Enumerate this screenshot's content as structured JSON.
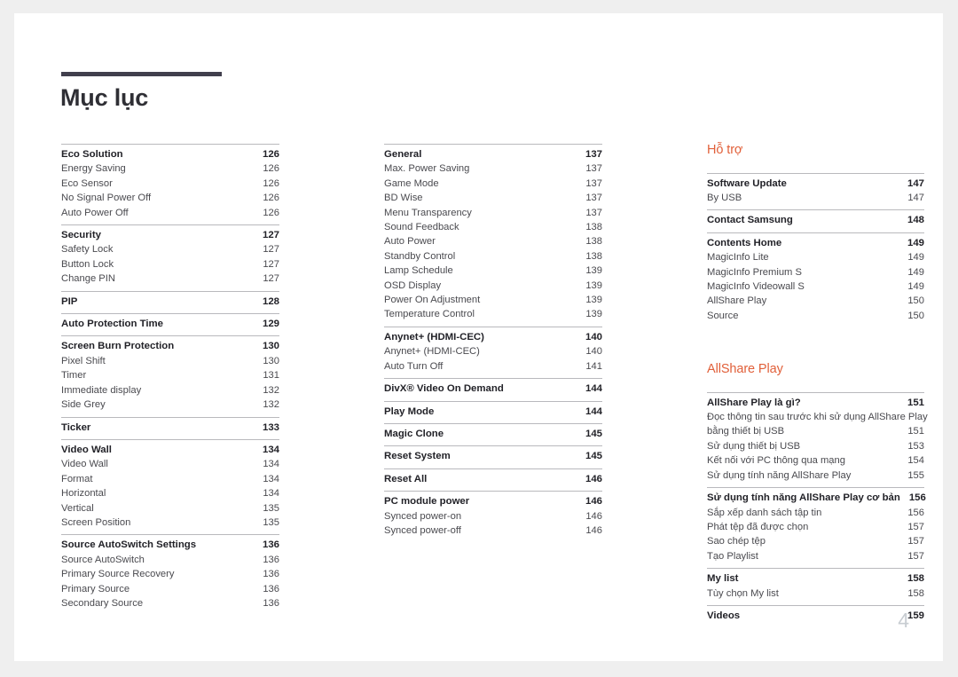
{
  "document": {
    "title": "Mục lục",
    "folio": "4",
    "accent_color": "#e1603a",
    "rule_color": "#413f4d"
  },
  "columns": [
    {
      "name": "column-one",
      "heading": null,
      "groups": [
        {
          "rows": [
            {
              "label": "Eco Solution",
              "page": "126",
              "type": "head"
            },
            {
              "label": "Energy Saving",
              "page": "126",
              "type": "sub"
            },
            {
              "label": "Eco Sensor",
              "page": "126",
              "type": "sub"
            },
            {
              "label": "No Signal Power Off",
              "page": "126",
              "type": "sub"
            },
            {
              "label": "Auto Power Off",
              "page": "126",
              "type": "sub"
            }
          ]
        },
        {
          "rows": [
            {
              "label": "Security",
              "page": "127",
              "type": "head"
            },
            {
              "label": "Safety Lock",
              "page": "127",
              "type": "sub"
            },
            {
              "label": "Button Lock",
              "page": "127",
              "type": "sub"
            },
            {
              "label": "Change PIN",
              "page": "127",
              "type": "sub"
            }
          ]
        },
        {
          "rows": [
            {
              "label": "PIP",
              "page": "128",
              "type": "head"
            }
          ]
        },
        {
          "rows": [
            {
              "label": "Auto Protection Time",
              "page": "129",
              "type": "head"
            }
          ]
        },
        {
          "rows": [
            {
              "label": "Screen Burn Protection",
              "page": "130",
              "type": "head"
            },
            {
              "label": "Pixel Shift",
              "page": "130",
              "type": "sub"
            },
            {
              "label": "Timer",
              "page": "131",
              "type": "sub"
            },
            {
              "label": "Immediate display",
              "page": "132",
              "type": "sub"
            },
            {
              "label": "Side Grey",
              "page": "132",
              "type": "sub"
            }
          ]
        },
        {
          "rows": [
            {
              "label": "Ticker",
              "page": "133",
              "type": "head"
            }
          ]
        },
        {
          "rows": [
            {
              "label": "Video Wall",
              "page": "134",
              "type": "head"
            },
            {
              "label": "Video Wall",
              "page": "134",
              "type": "sub"
            },
            {
              "label": "Format",
              "page": "134",
              "type": "sub"
            },
            {
              "label": "Horizontal",
              "page": "134",
              "type": "sub"
            },
            {
              "label": "Vertical",
              "page": "135",
              "type": "sub"
            },
            {
              "label": "Screen Position",
              "page": "135",
              "type": "sub"
            }
          ]
        },
        {
          "rows": [
            {
              "label": "Source AutoSwitch Settings",
              "page": "136",
              "type": "head"
            },
            {
              "label": "Source AutoSwitch",
              "page": "136",
              "type": "sub"
            },
            {
              "label": "Primary Source Recovery",
              "page": "136",
              "type": "sub"
            },
            {
              "label": "Primary Source",
              "page": "136",
              "type": "sub"
            },
            {
              "label": "Secondary Source",
              "page": "136",
              "type": "sub"
            }
          ]
        }
      ]
    },
    {
      "name": "column-two",
      "heading": null,
      "groups": [
        {
          "rows": [
            {
              "label": "General",
              "page": "137",
              "type": "head"
            },
            {
              "label": "Max. Power Saving",
              "page": "137",
              "type": "sub"
            },
            {
              "label": "Game Mode",
              "page": "137",
              "type": "sub"
            },
            {
              "label": "BD Wise",
              "page": "137",
              "type": "sub"
            },
            {
              "label": "Menu Transparency",
              "page": "137",
              "type": "sub"
            },
            {
              "label": "Sound Feedback",
              "page": "138",
              "type": "sub"
            },
            {
              "label": "Auto Power",
              "page": "138",
              "type": "sub"
            },
            {
              "label": "Standby Control",
              "page": "138",
              "type": "sub"
            },
            {
              "label": "Lamp Schedule",
              "page": "139",
              "type": "sub"
            },
            {
              "label": "OSD Display",
              "page": "139",
              "type": "sub"
            },
            {
              "label": "Power On Adjustment",
              "page": "139",
              "type": "sub"
            },
            {
              "label": "Temperature Control",
              "page": "139",
              "type": "sub"
            }
          ]
        },
        {
          "rows": [
            {
              "label": "Anynet+ (HDMI-CEC)",
              "page": "140",
              "type": "head"
            },
            {
              "label": "Anynet+ (HDMI-CEC)",
              "page": "140",
              "type": "sub"
            },
            {
              "label": "Auto Turn Off",
              "page": "141",
              "type": "sub"
            }
          ]
        },
        {
          "rows": [
            {
              "label": "DivX® Video On Demand",
              "page": "144",
              "type": "head"
            }
          ]
        },
        {
          "rows": [
            {
              "label": "Play Mode",
              "page": "144",
              "type": "head"
            }
          ]
        },
        {
          "rows": [
            {
              "label": "Magic Clone",
              "page": "145",
              "type": "head"
            }
          ]
        },
        {
          "rows": [
            {
              "label": "Reset System",
              "page": "145",
              "type": "head"
            }
          ]
        },
        {
          "rows": [
            {
              "label": "Reset All",
              "page": "146",
              "type": "head"
            }
          ]
        },
        {
          "rows": [
            {
              "label": "PC module power",
              "page": "146",
              "type": "head"
            },
            {
              "label": "Synced power-on",
              "page": "146",
              "type": "sub"
            },
            {
              "label": "Synced power-off",
              "page": "146",
              "type": "sub"
            }
          ]
        }
      ]
    },
    {
      "name": "column-three",
      "heading": "Hỗ trợ",
      "groups": [
        {
          "rows": [
            {
              "label": "Software Update",
              "page": "147",
              "type": "head"
            },
            {
              "label": "By USB",
              "page": "147",
              "type": "sub"
            }
          ]
        },
        {
          "rows": [
            {
              "label": "Contact Samsung",
              "page": "148",
              "type": "head"
            }
          ]
        },
        {
          "rows": [
            {
              "label": "Contents Home",
              "page": "149",
              "type": "head"
            },
            {
              "label": "MagicInfo Lite",
              "page": "149",
              "type": "sub"
            },
            {
              "label": "MagicInfo Premium S",
              "page": "149",
              "type": "sub"
            },
            {
              "label": "MagicInfo Videowall S",
              "page": "149",
              "type": "sub"
            },
            {
              "label": "AllShare Play",
              "page": "150",
              "type": "sub"
            },
            {
              "label": "Source",
              "page": "150",
              "type": "sub"
            }
          ]
        }
      ],
      "heading2": "AllShare Play",
      "groups2": [
        {
          "rows": [
            {
              "label": "AllShare Play là gì?",
              "page": "151",
              "type": "head"
            },
            {
              "label": "Đọc thông tin sau trước khi sử dụng AllShare Play",
              "page": "",
              "type": "wrap-first"
            },
            {
              "label": "bằng thiết bị USB",
              "page": "151",
              "type": "wrap-second"
            },
            {
              "label": "Sử dụng thiết bị USB",
              "page": "153",
              "type": "sub"
            },
            {
              "label": "Kết nối với PC thông qua mạng",
              "page": "154",
              "type": "sub"
            },
            {
              "label": "Sử dụng tính năng AllShare Play",
              "page": "155",
              "type": "sub"
            }
          ]
        },
        {
          "rows": [
            {
              "label": "Sử dụng tính năng AllShare Play cơ bản",
              "page": "156",
              "type": "head"
            },
            {
              "label": "Sắp xếp danh sách tập tin",
              "page": "156",
              "type": "sub"
            },
            {
              "label": "Phát tệp đã được chọn",
              "page": "157",
              "type": "sub"
            },
            {
              "label": "Sao chép tệp",
              "page": "157",
              "type": "sub"
            },
            {
              "label": "Tạo Playlist",
              "page": "157",
              "type": "sub"
            }
          ]
        },
        {
          "rows": [
            {
              "label": "My list",
              "page": "158",
              "type": "head"
            },
            {
              "label": "Tùy chọn My list",
              "page": "158",
              "type": "sub"
            }
          ]
        },
        {
          "rows": [
            {
              "label": "Videos",
              "page": "159",
              "type": "head"
            }
          ]
        }
      ]
    }
  ]
}
